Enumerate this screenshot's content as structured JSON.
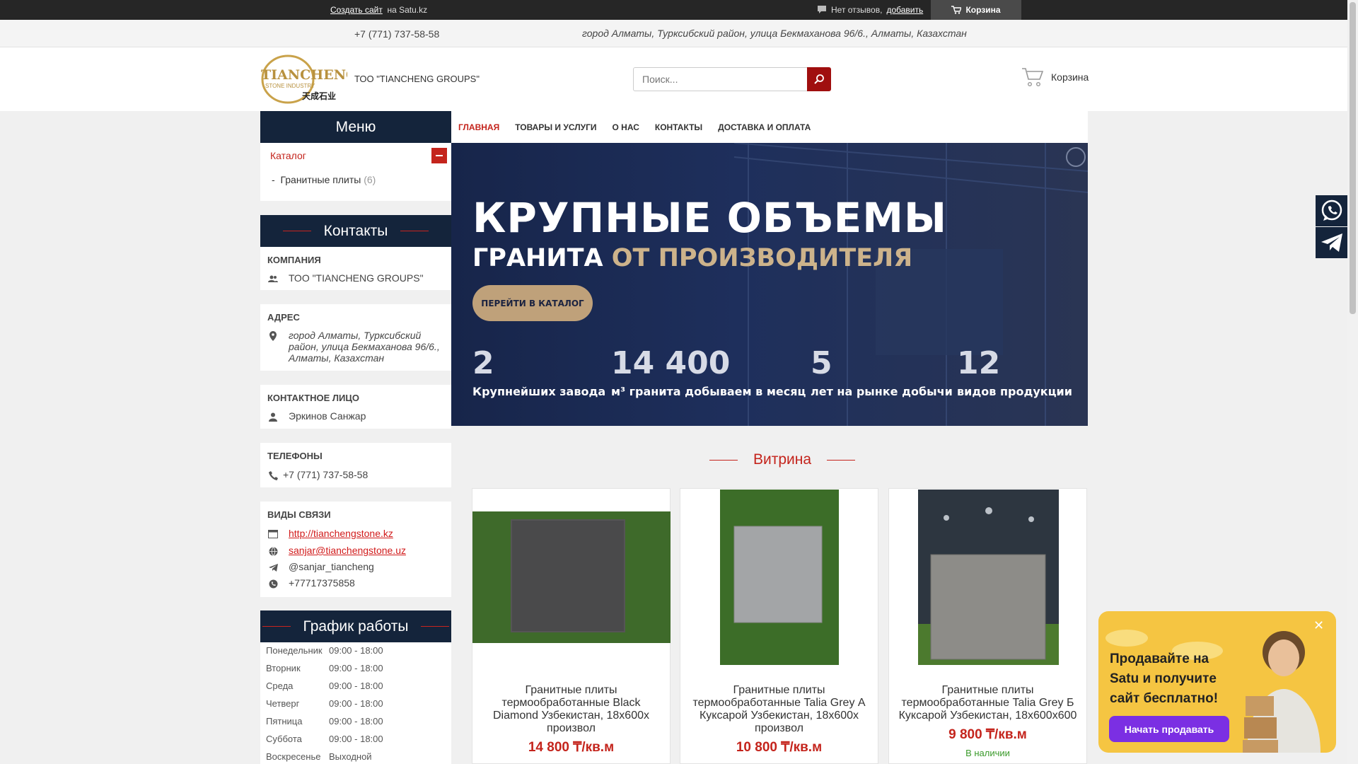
{
  "topbar": {
    "create_site": "Создать сайт",
    "on_satu": "на Satu.kz",
    "no_reviews": "Нет отзывов,",
    "add": "добавить",
    "cart": "Корзина"
  },
  "strip": {
    "phone": "+7 (771) 737-58-58",
    "address": "город Алматы, Турксибский район, улица Бекмаханова 96/6., Алматы, Казахстан"
  },
  "header": {
    "logo_text": "TIANCHENG",
    "logo_sub": "STONE INDUSTRY",
    "logo_cn": "天成石业",
    "company": "ТОО \"TIANCHENG GROUPS\"",
    "search_placeholder": "Поиск...",
    "cart": "Корзина"
  },
  "nav": {
    "items": [
      "ГЛАВНАЯ",
      "ТОВАРЫ И УСЛУГИ",
      "О НАС",
      "КОНТАКТЫ",
      "ДОСТАВКА И ОПЛАТА"
    ]
  },
  "sidebar": {
    "menu_title": "Меню",
    "catalog": "Каталог",
    "catalog_item": "Гранитные плиты",
    "catalog_count": "(6)",
    "contacts_title": "Контакты",
    "company_h": "КОМПАНИЯ",
    "company": "ТОО \"TIANCHENG GROUPS\"",
    "address_h": "АДРЕС",
    "address_l1": "город Алматы, Турксибский",
    "address_l2": "район, улица Бекмаханова 96/6.,",
    "address_l3": "Алматы, Казахстан",
    "person_h": "КОНТАКТНОЕ ЛИЦО",
    "person": "Эркинов Санжар",
    "phones_h": "ТЕЛЕФОНЫ",
    "phone": "+7 (771) 737-58-58",
    "links_h": "ВИДЫ СВЯЗИ",
    "site": "http://tianchengstone.kz",
    "email": "sanjar@tianchengstone.uz",
    "telegram": "@sanjar_tiancheng",
    "whatsapp": "+77717375858",
    "schedule_title": "График работы",
    "schedule": [
      {
        "day": "Понедельник",
        "time": "09:00 - 18:00"
      },
      {
        "day": "Вторник",
        "time": "09:00 - 18:00"
      },
      {
        "day": "Среда",
        "time": "09:00 - 18:00"
      },
      {
        "day": "Четверг",
        "time": "09:00 - 18:00"
      },
      {
        "day": "Пятница",
        "time": "09:00 - 18:00"
      },
      {
        "day": "Суббота",
        "time": "09:00 - 18:00"
      },
      {
        "day": "Воскресенье",
        "time": "Выходной"
      }
    ]
  },
  "banner": {
    "line1": "КРУПНЫЕ ОБЪЕМЫ",
    "line2a": "ГРАНИТА",
    "line2b": "ОТ ПРОИЗВОДИТЕЛЯ",
    "cta": "ПЕРЕЙТИ В КАТАЛОГ",
    "stats": [
      {
        "n": "2",
        "l": "Крупнейших завода"
      },
      {
        "n": "14 400",
        "l": "м³ гранита добываем в месяц"
      },
      {
        "n": "5",
        "l": "лет на рынке добычи"
      },
      {
        "n": "12",
        "l": "видов продукции"
      }
    ]
  },
  "vitrina": {
    "title": "Витрина",
    "products": [
      {
        "title": "Гранитные плиты термообработанные Black Diamond Узбекистан, 18x600x произвол",
        "price": "14 800 ₸/кв.м",
        "avail": ""
      },
      {
        "title": "Гранитные плиты термообработанные Talia Grey А Куксарой Узбекистан, 18x600x произвол",
        "price": "10 800 ₸/кв.м",
        "avail": ""
      },
      {
        "title": "Гранитные плиты термообработанные Talia Grey Б Куксарой Узбекистан, 18x600x600",
        "price": "9 800 ₸/кв.м",
        "avail": "В наличии"
      }
    ]
  },
  "promo": {
    "text_l1": "Продавайте на",
    "text_l2": "Satu и получите",
    "text_l3": "сайт бесплатно!",
    "button": "Начать продавать"
  },
  "colors": {
    "accent": "#c4241c",
    "navy": "#14243b",
    "promo": "#f5c542",
    "promo_button": "#7b2fe3"
  }
}
